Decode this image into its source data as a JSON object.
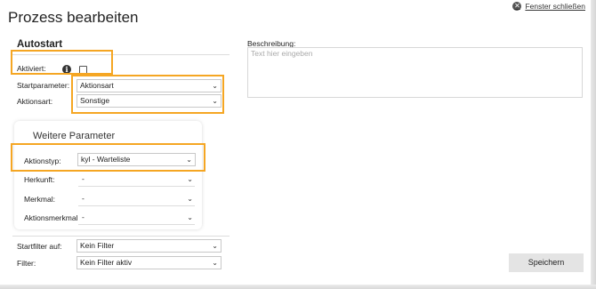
{
  "dialog": {
    "title": "Prozess bearbeiten",
    "close_label": "Fenster schließen"
  },
  "autostart": {
    "section_title": "Autostart",
    "aktiviert_label": "Aktiviert:",
    "aktiviert_checked": false,
    "startparameter_label": "Startparameter:",
    "startparameter_value": "Aktionsart",
    "aktionsart_label": "Aktionsart:",
    "aktionsart_value": "Sonstige"
  },
  "weitere_parameter": {
    "title": "Weitere Parameter",
    "aktionstyp_label": "Aktionstyp:",
    "aktionstyp_value": "kyl - Warteliste",
    "herkunft_label": "Herkunft:",
    "herkunft_value": "-",
    "merkmal_label": "Merkmal:",
    "merkmal_value": "-",
    "aktionsmerkmal_label": "Aktionsmerkmal",
    "aktionsmerkmal_value": "-"
  },
  "filters": {
    "startfilter_label": "Startfilter auf:",
    "startfilter_value": "Kein Filter",
    "filter_label": "Filter:",
    "filter_value": "Kein Filter aktiv"
  },
  "description": {
    "label": "Beschreibung:",
    "placeholder": "Text hier eingeben"
  },
  "actions": {
    "save_label": "Speichern"
  },
  "colors": {
    "highlight": "#f5a623",
    "save_button_bg": "#e4e4e4"
  }
}
